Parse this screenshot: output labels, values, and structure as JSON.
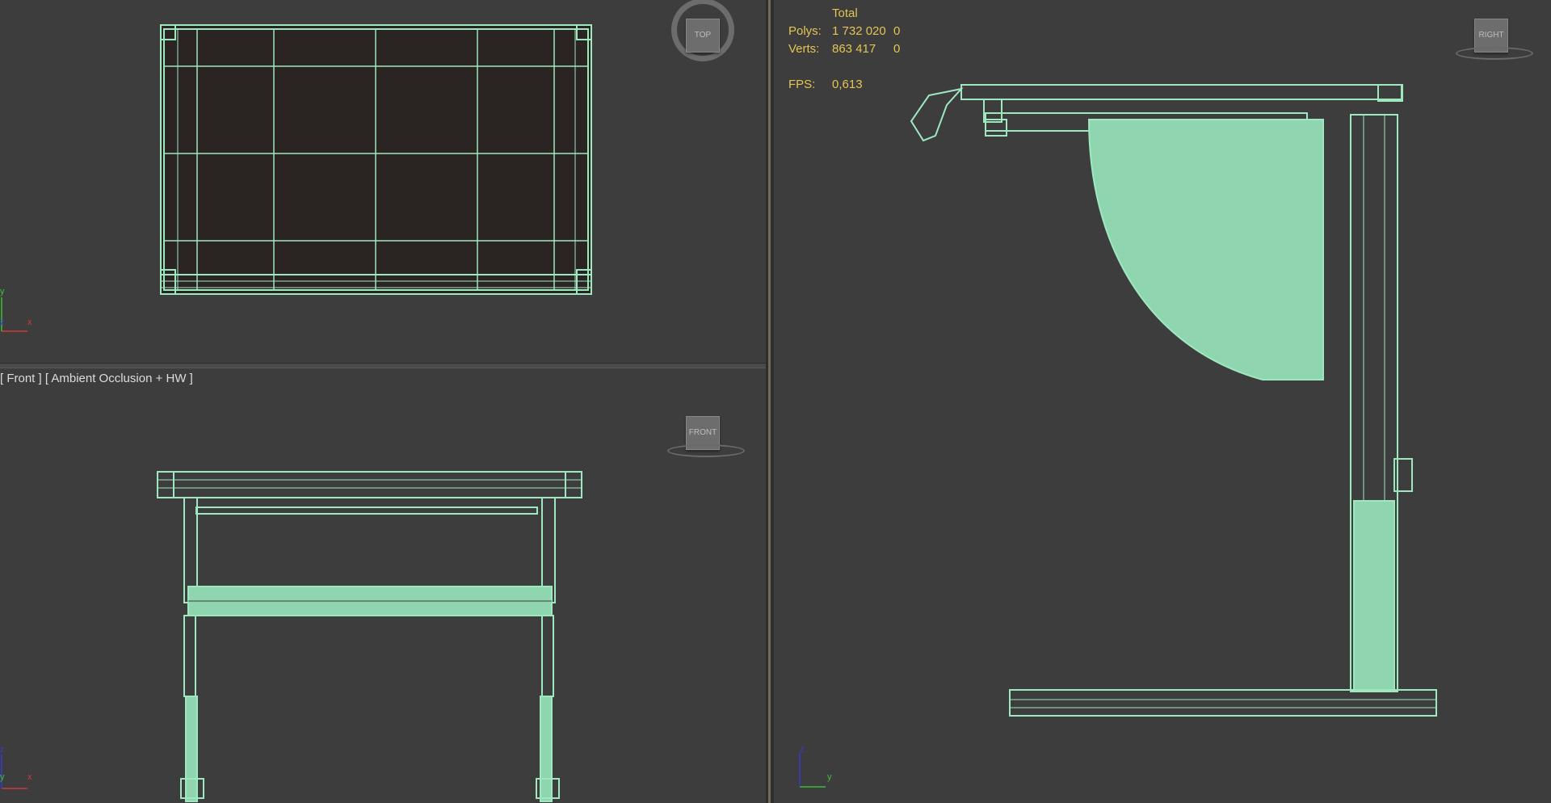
{
  "viewports": {
    "top": {
      "navcube_label": "TOP"
    },
    "front": {
      "label_view": "[ Front ]",
      "label_shading": "[ Ambient Occlusion + HW ]",
      "navcube_label": "FRONT"
    },
    "right": {
      "navcube_label": "RIGHT"
    }
  },
  "stats": {
    "header": "Total",
    "polys_label": "Polys:",
    "polys_value": "1 732 020",
    "polys_selected": "0",
    "verts_label": "Verts:",
    "verts_value": "863 417",
    "verts_selected": "0",
    "fps_label": "FPS:",
    "fps_value": "0,613"
  },
  "axes": {
    "x": "x",
    "y": "y",
    "z": "z"
  },
  "colors": {
    "wireframe": "#9ee8c0",
    "background": "#3d3d3d",
    "stats_text": "#e5c453",
    "top_surface": "#2a2523",
    "axis_x": "#d03a3a",
    "axis_y": "#3ac03a",
    "axis_z": "#3a3ad0"
  }
}
